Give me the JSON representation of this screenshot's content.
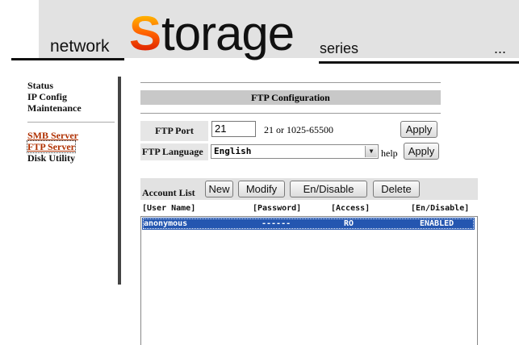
{
  "header": {
    "word_left": "network",
    "big_S": "S",
    "big_rest": "torage",
    "word_right": "series",
    "more": "..."
  },
  "sidebar": {
    "items": [
      {
        "label": "Status"
      },
      {
        "label": "IP Config"
      },
      {
        "label": "Maintenance"
      },
      {
        "label": "SMB Server"
      },
      {
        "label": "FTP Server"
      },
      {
        "label": "Disk Utility"
      }
    ]
  },
  "ftp": {
    "title": "FTP Configuration",
    "port_label": "FTP Port",
    "port_value": "21",
    "port_hint": "21 or 1025-65500",
    "apply_label": "Apply",
    "language_label": "FTP Language",
    "language_value": "English",
    "help_label": "help",
    "apply2_label": "Apply"
  },
  "accounts": {
    "title": "Account List",
    "buttons": {
      "new": "New",
      "modify": "Modify",
      "endisable": "En/Disable",
      "delete": "Delete"
    },
    "columns": [
      "[User Name]",
      "[Password]",
      "[Access]",
      "[En/Disable]"
    ],
    "rows": [
      {
        "user": "anonymous",
        "password": "------",
        "access": "RO",
        "status": "ENABLED"
      }
    ]
  },
  "colors": {
    "link": "#b03000",
    "selection": "#2456b0",
    "header_bg": "#e2e2e2"
  }
}
